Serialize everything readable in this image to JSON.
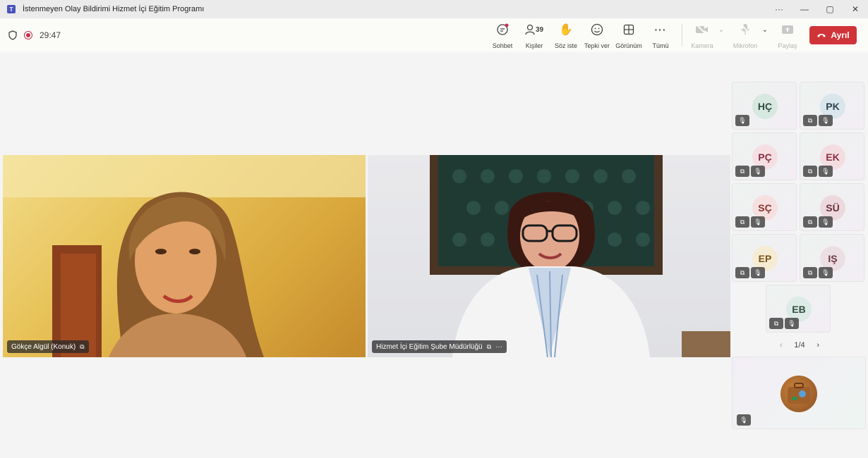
{
  "window": {
    "title": "İstenmeyen Olay Bildirimi Hizmet İçi Eğitim Programı",
    "controls": [
      "···",
      "—",
      "▢",
      "✕"
    ]
  },
  "toolbar": {
    "timer": "29:47",
    "chat_label": "Sohbet",
    "people_label": "Kişiler",
    "people_count": "39",
    "raise_hand_label": "Söz iste",
    "react_label": "Tepki ver",
    "view_label": "Görünüm",
    "more_label": "Tümü",
    "camera_label": "Kamera",
    "mic_label": "Mikrofon",
    "share_label": "Paylaş",
    "leave_label": "Ayrıl"
  },
  "videos": [
    {
      "name": "Gökçe Algül (Konuk)"
    },
    {
      "name": "Hizmet İçi Eğitim Şube Müdürlüğü"
    }
  ],
  "participants": [
    {
      "initials": "HÇ",
      "color": "#d7e8e0",
      "text_color": "#2f4f3f"
    },
    {
      "initials": "PK",
      "color": "#d9e6ec",
      "text_color": "#2f4550"
    },
    {
      "initials": "PÇ",
      "color": "#f6dfe3",
      "text_color": "#8a2f43"
    },
    {
      "initials": "EK",
      "color": "#f4dde1",
      "text_color": "#8a2f43"
    },
    {
      "initials": "SÇ",
      "color": "#f6e0df",
      "text_color": "#8a3030"
    },
    {
      "initials": "SÜ",
      "color": "#ecd9dd",
      "text_color": "#6a2f3a"
    },
    {
      "initials": "EP",
      "color": "#f6ebd3",
      "text_color": "#7a5418"
    },
    {
      "initials": "IŞ",
      "color": "#ecdfe3",
      "text_color": "#6a3a45"
    },
    {
      "initials": "EB",
      "color": "#dcebe5",
      "text_color": "#2f4f3f"
    }
  ],
  "pager": {
    "text": "1/4"
  }
}
